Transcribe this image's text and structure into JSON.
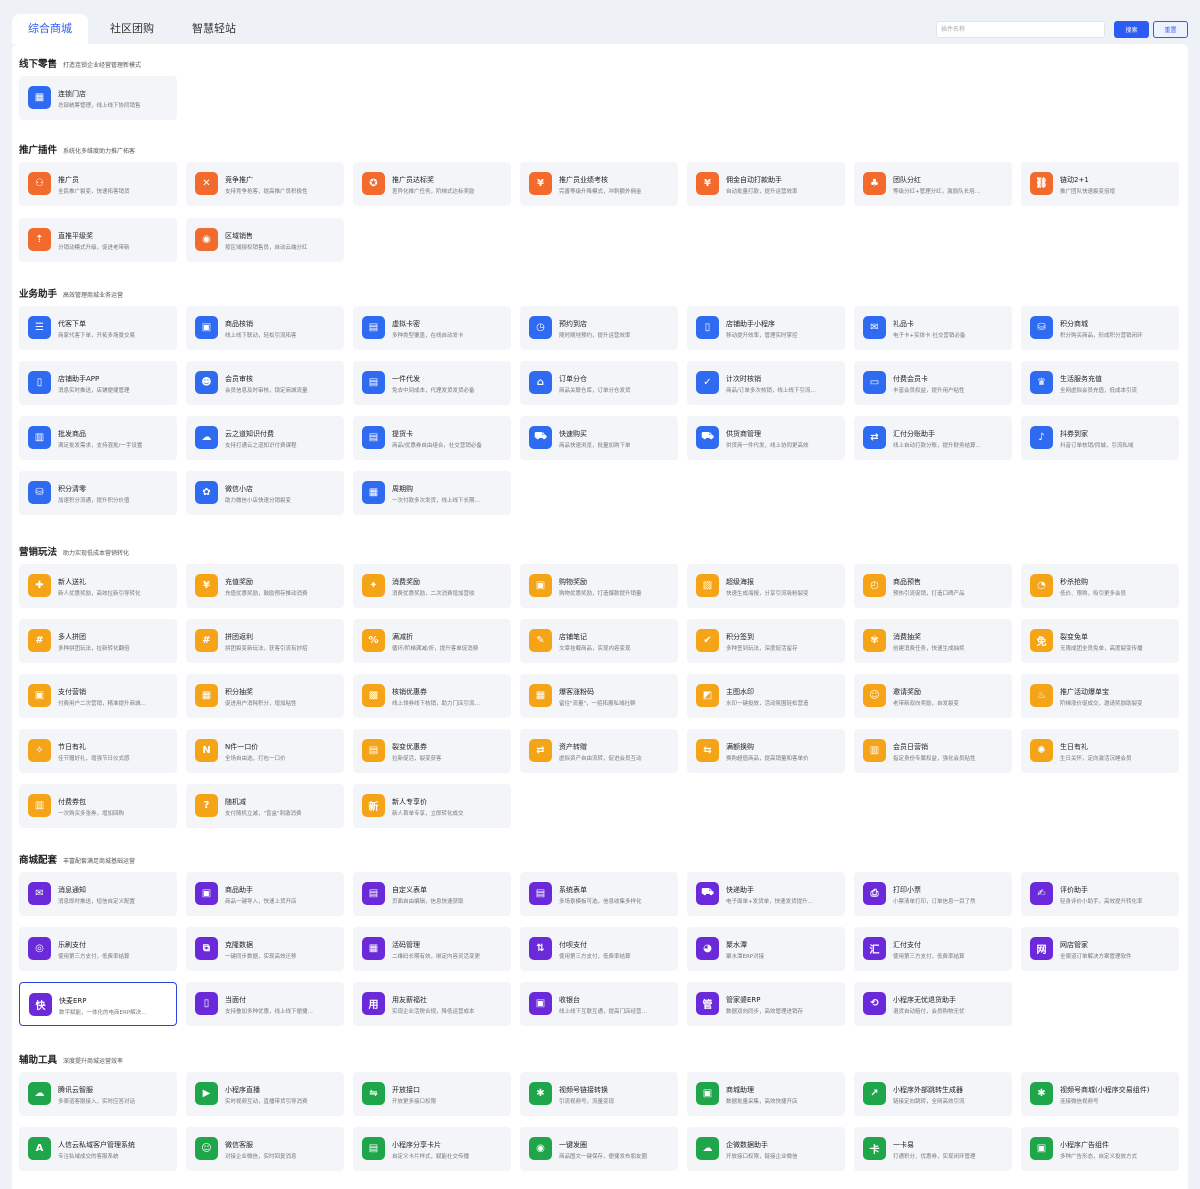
{
  "tabs": [
    "综合商城",
    "社区团购",
    "智慧轻站"
  ],
  "search": {
    "placeholder": "插件名称",
    "search_label": "搜索",
    "reset_label": "重置"
  },
  "colors": {
    "accent": "#2b5cf6",
    "blue": "#2f6bf0",
    "orange": "#f26b2c",
    "yellow": "#f5a417",
    "purple": "#6a2ad9",
    "green": "#1fa64a"
  },
  "sections": [
    {
      "title": "线下零售",
      "subtitle": "打造连锁企业经营管理新模式",
      "color": "blue",
      "items": [
        {
          "name": "连锁门店",
          "desc": "总部统筹管理，线上线下协同销售",
          "icon": "store-icon"
        }
      ]
    },
    {
      "title": "推广插件",
      "subtitle": "系统化多维度助力推广拓客",
      "color": "orange",
      "items": [
        {
          "name": "推广员",
          "desc": "全民推广裂变，快速拓客销货",
          "icon": "promoter-icon"
        },
        {
          "name": "竞争推广",
          "desc": "支持竞争抢客，提高推广员积极性",
          "icon": "compete-icon"
        },
        {
          "name": "推广员达标奖",
          "desc": "差异化推广任务，阶梯式达标奖励",
          "icon": "target-icon"
        },
        {
          "name": "推广员业绩考核",
          "desc": "完善等级升降模式，冲刺额外佣金",
          "icon": "performance-icon"
        },
        {
          "name": "佣金自动打款助手",
          "desc": "自动批量打款，提升运营效率",
          "icon": "payout-icon"
        },
        {
          "name": "团队分红",
          "desc": "等级分红+管理分红，激励队长培…",
          "icon": "team-icon"
        },
        {
          "name": "链动2+1",
          "desc": "推广团队快速裂变倍增",
          "icon": "chain-icon"
        },
        {
          "name": "直推平级奖",
          "desc": "分销动模式升级，促进老带新",
          "icon": "direct-icon"
        },
        {
          "name": "区域销售",
          "desc": "按区域授权销售员，自动云端分红",
          "icon": "region-icon"
        }
      ]
    },
    {
      "title": "业务助手",
      "subtitle": "高效管理商城业务运营",
      "color": "blue",
      "items": [
        {
          "name": "代客下单",
          "desc": "商家代客下单，开拓多场景交易",
          "icon": "order-icon"
        },
        {
          "name": "商品核销",
          "desc": "线上线下联动，轻松引流拓客",
          "icon": "verify-icon"
        },
        {
          "name": "虚拟卡密",
          "desc": "多种类型覆盖，在线自动发卡",
          "icon": "card-key-icon"
        },
        {
          "name": "预约到店",
          "desc": "随时随地预约，提升运营效率",
          "icon": "booking-icon"
        },
        {
          "name": "店铺助手小程序",
          "desc": "移动提升效率，管理实时掌控",
          "icon": "shop-app-icon"
        },
        {
          "name": "礼品卡",
          "desc": "电子卡+实体卡 社交营销必备",
          "icon": "gift-card-icon"
        },
        {
          "name": "积分商城",
          "desc": "积分购买商品，形成积分营销闭环",
          "icon": "points-mall-icon"
        },
        {
          "name": "店铺助手APP",
          "desc": "消息实时推送，店铺便捷管理",
          "icon": "shop-helper-icon"
        },
        {
          "name": "会员审核",
          "desc": "会员信息及时审核，锁定商城流量",
          "icon": "member-audit-icon"
        },
        {
          "name": "一件代发",
          "desc": "免去中间成本，代理发货发货必备",
          "icon": "dropship-icon"
        },
        {
          "name": "订单分仓",
          "desc": "商品关联仓库，订单分仓发货",
          "icon": "warehouse-icon"
        },
        {
          "name": "计次时核销",
          "desc": "商品/订单多次核销，线上线下引流…",
          "icon": "times-verify-icon"
        },
        {
          "name": "付费会员卡",
          "desc": "丰富会员权益，提升用户粘性",
          "icon": "vip-card-icon"
        },
        {
          "name": "生活服务充值",
          "desc": "全网虚拟会员充值，低成本引流",
          "icon": "crown-icon"
        },
        {
          "name": "批发商品",
          "desc": "满足批发需求，支持混批/一手设置",
          "icon": "wholesale-icon"
        },
        {
          "name": "云之道知识付费",
          "desc": "支持打通云之道知识付费课程",
          "icon": "cloud-icon"
        },
        {
          "name": "提货卡",
          "desc": "商品/优惠券自由组合，社交营销必备",
          "icon": "pickup-card-icon"
        },
        {
          "name": "快速购买",
          "desc": "商品快速浏览，批量加购下单",
          "icon": "quick-buy-icon"
        },
        {
          "name": "供货商管理",
          "desc": "供货商一件代发，线上协同更高效",
          "icon": "supplier-icon"
        },
        {
          "name": "汇付分账助手",
          "desc": "线上自动打款分账，提升财务结算…",
          "icon": "split-icon"
        },
        {
          "name": "抖券到家",
          "desc": "抖音订单核销/同城，引流私域",
          "icon": "douyin-icon"
        },
        {
          "name": "积分清零",
          "desc": "加速积分流通，提升积分价值",
          "icon": "points-clear-icon"
        },
        {
          "name": "微信小店",
          "desc": "助力微信小店快速分销裂变",
          "icon": "wechat-shop-icon"
        },
        {
          "name": "周期购",
          "desc": "一次付款多次发货，线上线下长期…",
          "icon": "calendar-icon"
        }
      ]
    },
    {
      "title": "营销玩法",
      "subtitle": "助力实现低成本营销转化",
      "color": "yellow",
      "items": [
        {
          "name": "新人送礼",
          "desc": "新人优惠奖励，高效拉新引导转化",
          "icon": "newbie-gift-icon"
        },
        {
          "name": "充值奖励",
          "desc": "充值优惠奖励，鼓励预存推动消费",
          "icon": "recharge-icon"
        },
        {
          "name": "消费奖励",
          "desc": "消费优惠奖励，二次消费增加营收",
          "icon": "consume-reward-icon"
        },
        {
          "name": "购物奖励",
          "desc": "购物优惠奖励，打造爆款提升销量",
          "icon": "shopping-reward-icon"
        },
        {
          "name": "超级海报",
          "desc": "快速生成海报，分享引流吸粉裂变",
          "icon": "poster-icon"
        },
        {
          "name": "商品预售",
          "desc": "预热引流促销，打造口碑产品",
          "icon": "presale-icon"
        },
        {
          "name": "秒杀抢购",
          "desc": "低价、限购，吸引更多会员",
          "icon": "flash-sale-icon"
        },
        {
          "name": "多人拼团",
          "desc": "多种拼团玩法，拉新转化翻倍",
          "icon": "group-buy-icon"
        },
        {
          "name": "拼团返利",
          "desc": "拼团裂变新玩法，获客引流有妙招",
          "icon": "group-rebate-icon"
        },
        {
          "name": "满减折",
          "desc": "循环/阶梯满减/折，提升客单促消费",
          "icon": "discount-icon"
        },
        {
          "name": "店铺笔记",
          "desc": "文章挂载商品，实现内容变现",
          "icon": "notes-icon"
        },
        {
          "name": "积分签到",
          "desc": "多种签到玩法，深度促活留存",
          "icon": "checkin-icon"
        },
        {
          "name": "消费抽奖",
          "desc": "创建消费任务，快速生成抽奖",
          "icon": "lottery-icon"
        },
        {
          "name": "裂变免单",
          "desc": "无限成团全员免单，高度裂变传播",
          "icon": "free-order-icon"
        },
        {
          "name": "支付营销",
          "desc": "付费用户二次营销，精准提升商城…",
          "icon": "pay-marketing-icon"
        },
        {
          "name": "积分抽奖",
          "desc": "促进用户消耗积分，增加粘性",
          "icon": "points-lottery-icon"
        },
        {
          "name": "核销优惠券",
          "desc": "线上领券线下核销，助力门店引流…",
          "icon": "coupon-verify-icon"
        },
        {
          "name": "爆客涨粉码",
          "desc": "留住\"流量\"，一招拓展私域社群",
          "icon": "qrcode-icon"
        },
        {
          "name": "主图水印",
          "desc": "水印一键投放，活动氛围轻松营造",
          "icon": "watermark-icon"
        },
        {
          "name": "邀请奖励",
          "desc": "老带新双向奖励，自发裂变",
          "icon": "invite-icon"
        },
        {
          "name": "推广活动爆单宝",
          "desc": "阶梯涨价促成交，邀请奖励助裂变",
          "icon": "fire-icon"
        },
        {
          "name": "节日有礼",
          "desc": "佳节赠好礼，增强节日仪式感",
          "icon": "festival-icon"
        },
        {
          "name": "N件一口价",
          "desc": "全场自由选，打包一口价",
          "icon": "bundle-icon"
        },
        {
          "name": "裂变优惠券",
          "desc": "拉新促活，裂变获客",
          "icon": "fission-coupon-icon"
        },
        {
          "name": "资产转赠",
          "desc": "虚拟资产自由流转，促进会员互动",
          "icon": "transfer-icon"
        },
        {
          "name": "满额换购",
          "desc": "换购超值商品，提高销量和客单价",
          "icon": "exchange-icon"
        },
        {
          "name": "会员日营销",
          "desc": "指定身份专属权益，强化会员粘性",
          "icon": "member-day-icon"
        },
        {
          "name": "生日有礼",
          "desc": "生日关怀，定向激活沉睡会员",
          "icon": "birthday-icon"
        },
        {
          "name": "付费券包",
          "desc": "一次购买多张券，增加回购",
          "icon": "coupon-pack-icon"
        },
        {
          "name": "随机减",
          "desc": "支付随机立减，\"盲盒\"刺激消费",
          "icon": "random-icon"
        },
        {
          "name": "新人专享价",
          "desc": "新人首单专享，立即转化成交",
          "icon": "new-price-icon"
        }
      ]
    },
    {
      "title": "商城配套",
      "subtitle": "丰富配套满足商城基础运营",
      "color": "purple",
      "items": [
        {
          "name": "消息通知",
          "desc": "消息即时推送，短信自定义配置",
          "icon": "message-icon"
        },
        {
          "name": "商品助手",
          "desc": "商品一键导入，快速上货开店",
          "icon": "goods-helper-icon"
        },
        {
          "name": "自定义表单",
          "desc": "页面自由编辑，信息快速获取",
          "icon": "form-icon"
        },
        {
          "name": "系统表单",
          "desc": "多场景模板可选，信息收集多样化",
          "icon": "system-form-icon"
        },
        {
          "name": "快递助手",
          "desc": "电子面单+发货单，快速发货提升…",
          "icon": "express-icon"
        },
        {
          "name": "打印小票",
          "desc": "小票清单打印，订单信息一目了然",
          "icon": "printer-icon"
        },
        {
          "name": "评价助手",
          "desc": "轻身评价小助手，高效提升转化率",
          "icon": "review-icon"
        },
        {
          "name": "乐刷支付",
          "desc": "使用第三方支付，低费率结算",
          "icon": "leshua-icon"
        },
        {
          "name": "克隆数据",
          "desc": "一键同步数据，实现高效迁移",
          "icon": "clone-icon"
        },
        {
          "name": "活码管理",
          "desc": "二维码长期有效，绑定内容灵活变更",
          "icon": "live-code-icon"
        },
        {
          "name": "付呗支付",
          "desc": "使用第三方支付，低费率结算",
          "icon": "fubei-icon"
        },
        {
          "name": "聚水潭",
          "desc": "聚水潭ERP对接",
          "icon": "jushuitan-icon"
        },
        {
          "name": "汇付支付",
          "desc": "使用第三方支付，低费率结算",
          "icon": "huifu-icon"
        },
        {
          "name": "网店管家",
          "desc": "全渠道订单解决方案管理软件",
          "icon": "wangdian-icon"
        },
        {
          "name": "快麦ERP",
          "desc": "数字赋能，一体化的电商ERP解决…",
          "icon": "kuaimai-icon",
          "selected": true
        },
        {
          "name": "当面付",
          "desc": "支持叠加多种优惠，线上线下便捷…",
          "icon": "face-pay-icon"
        },
        {
          "name": "用友薪福社",
          "desc": "实现企业活税合规，降低运营成本",
          "icon": "yonyou-icon"
        },
        {
          "name": "收银台",
          "desc": "线上线下互联互通，提高门店经营…",
          "icon": "cashier-icon"
        },
        {
          "name": "管家婆ERP",
          "desc": "数据双向同步，高效管理进销存",
          "icon": "guanjiapo-icon"
        },
        {
          "name": "小程序无忧退货助手",
          "desc": "退货自动赔付，会员购物无忧",
          "icon": "return-icon"
        }
      ]
    },
    {
      "title": "辅助工具",
      "subtitle": "深度提升商城运营效率",
      "color": "green",
      "items": [
        {
          "name": "腾讯云智服",
          "desc": "多渠道客服接入，实时应答对话",
          "icon": "tencent-cloud-icon"
        },
        {
          "name": "小程序直播",
          "desc": "实时视频互动，直播带货引导消费",
          "icon": "live-icon"
        },
        {
          "name": "开放接口",
          "desc": "开放更多接口权限",
          "icon": "api-icon"
        },
        {
          "name": "视频号链接转换",
          "desc": "引流视频号，流量变现",
          "icon": "channels-icon"
        },
        {
          "name": "商城助理",
          "desc": "数据批量采集，高效快捷开店",
          "icon": "assistant-icon"
        },
        {
          "name": "小程序外部跳转生成器",
          "desc": "链接定向跳转，全网高效引流",
          "icon": "jump-icon"
        },
        {
          "name": "视频号商城(小程序交易组件)",
          "desc": "连接微信视频号",
          "icon": "channels-mall-icon"
        },
        {
          "name": "人信云私域客户管理系统",
          "desc": "专注私域成交的客服系统",
          "icon": "crm-icon"
        },
        {
          "name": "微信客服",
          "desc": "对接企业微信，实时回复消息",
          "icon": "wechat-service-icon"
        },
        {
          "name": "小程序分享卡片",
          "desc": "自定义卡片样式，赋能社交传播",
          "icon": "share-card-icon"
        },
        {
          "name": "一键发圈",
          "desc": "商品图文一键保存，便捷发布朋友圈",
          "icon": "moments-icon"
        },
        {
          "name": "企微数据助手",
          "desc": "开放接口权限，链接企业微信",
          "icon": "wecom-data-icon"
        },
        {
          "name": "一卡易",
          "desc": "打通积分、优惠券，实现闭环管理",
          "icon": "yikayi-icon"
        },
        {
          "name": "小程序广告组件",
          "desc": "多种广告形态，自定义投放方式",
          "icon": "ad-icon"
        }
      ]
    }
  ]
}
